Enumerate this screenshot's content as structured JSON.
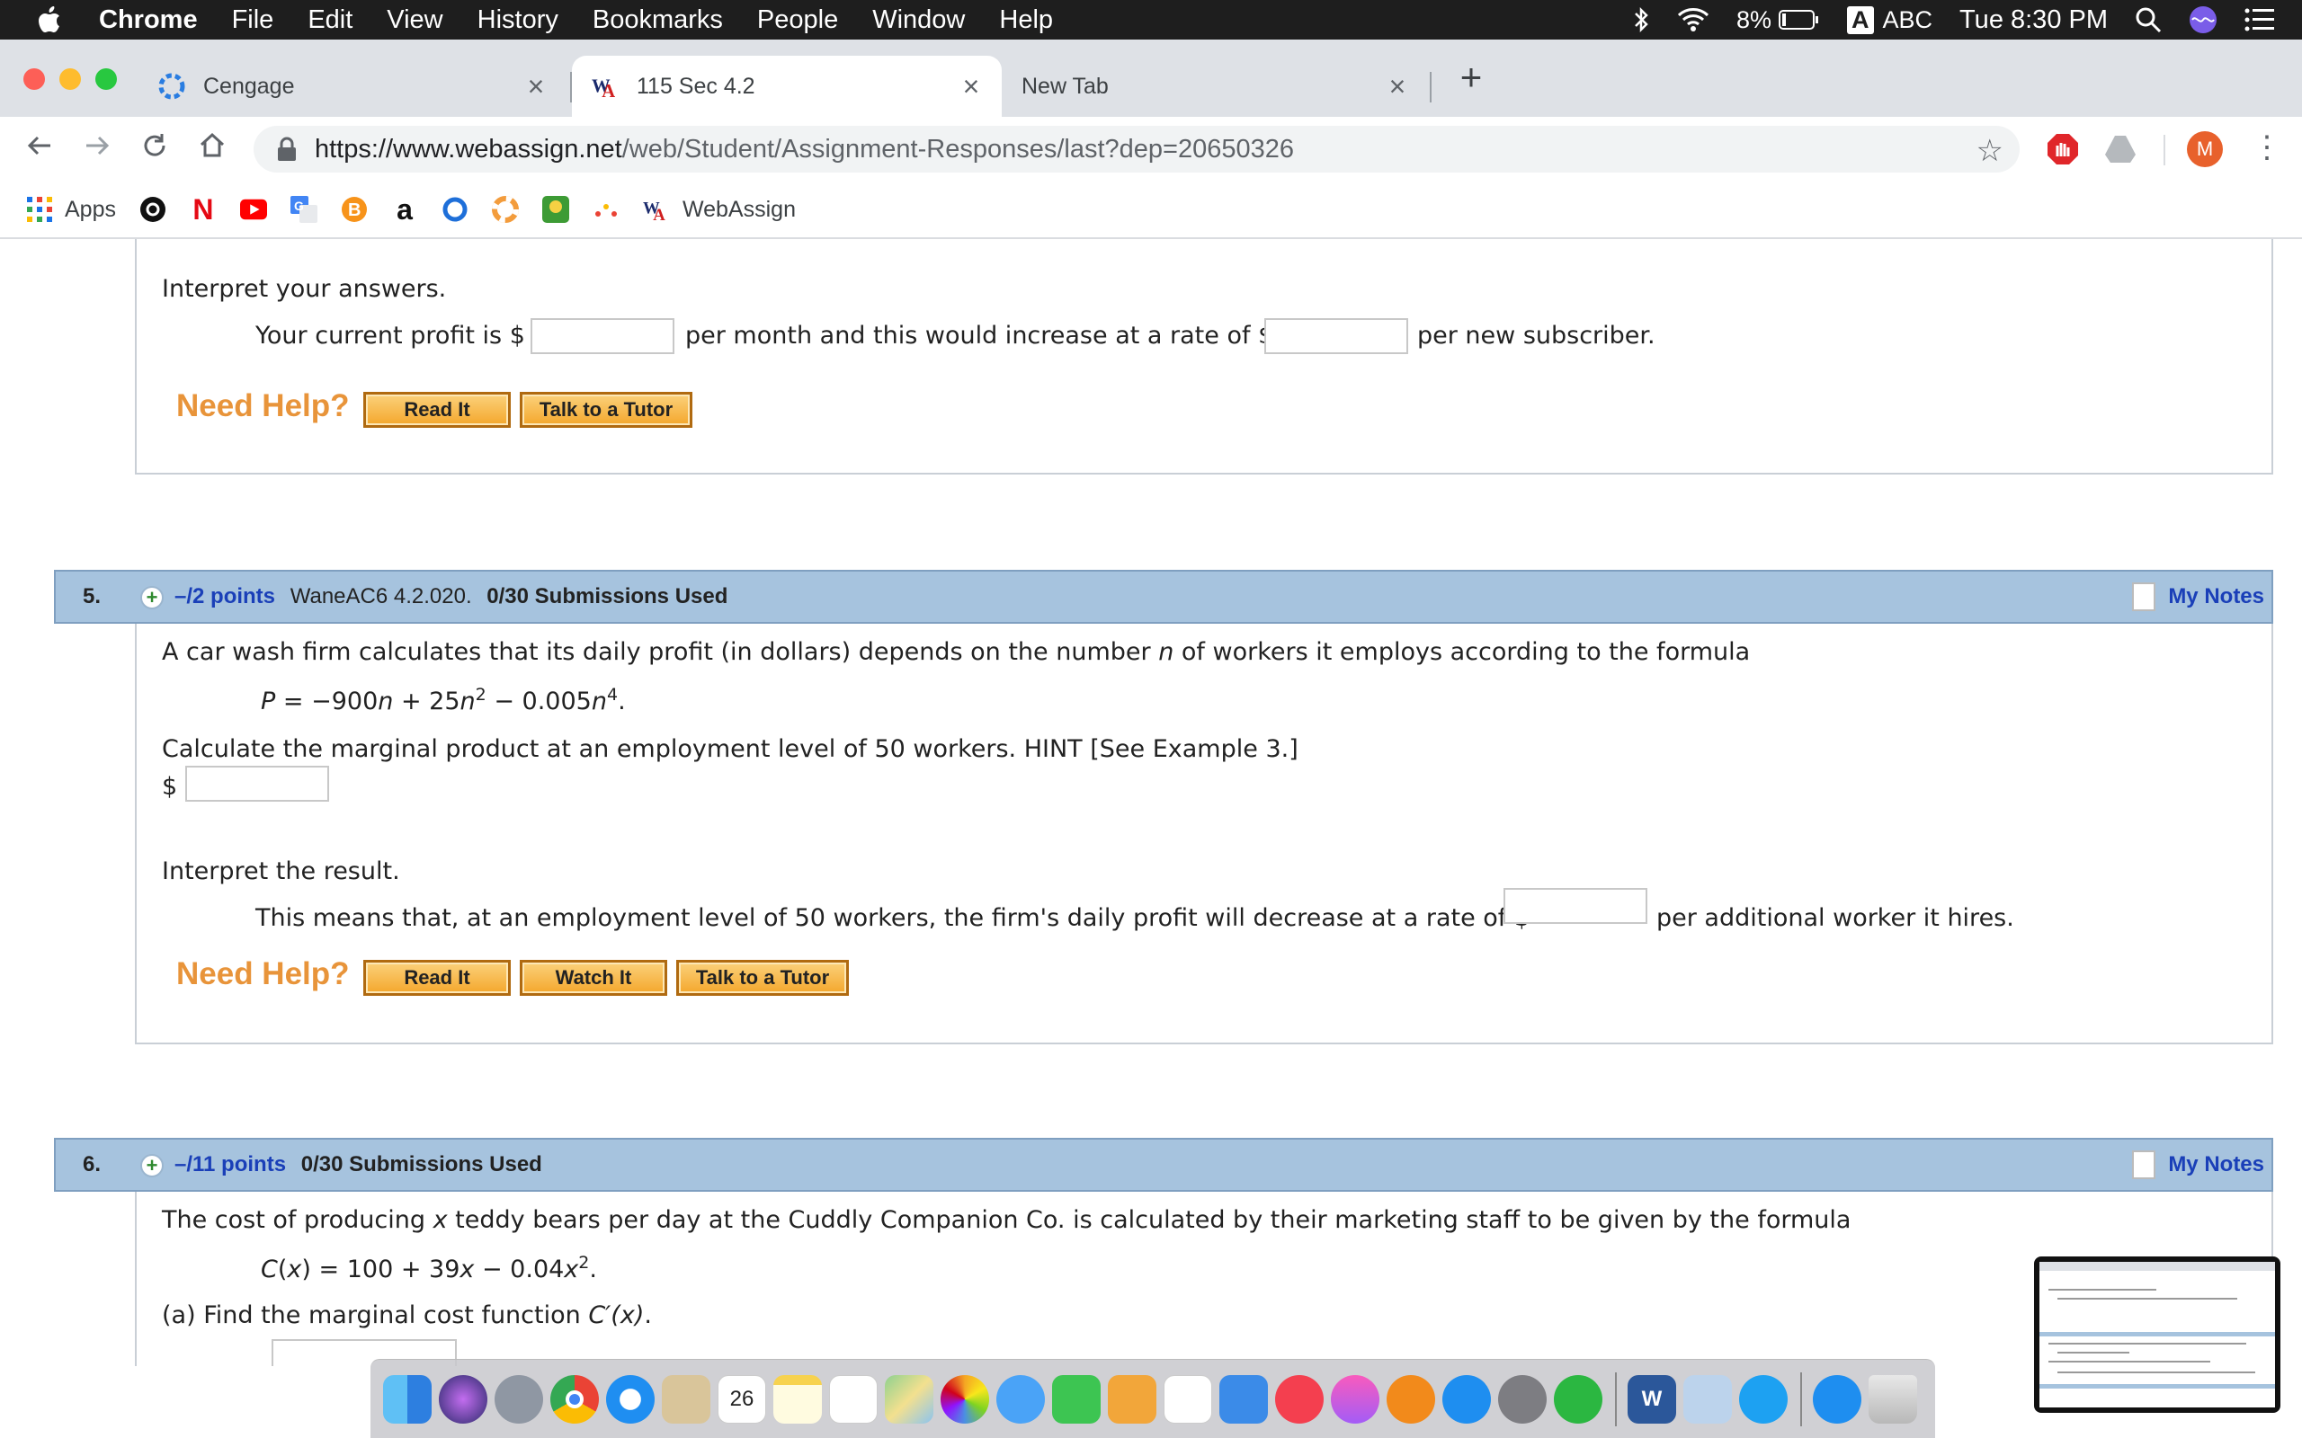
{
  "menubar": {
    "app": "Chrome",
    "items": [
      "File",
      "Edit",
      "View",
      "History",
      "Bookmarks",
      "People",
      "Window",
      "Help"
    ],
    "battery": "8%",
    "input_a": "A",
    "input": "ABC",
    "clock": "Tue 8:30 PM"
  },
  "tabs": [
    {
      "title": "Cengage"
    },
    {
      "title": "115 Sec 4.2"
    },
    {
      "title": "New Tab"
    }
  ],
  "toolbar": {
    "url_host": "https://www.webassign.net",
    "url_path": "/web/Student/Assignment-Responses/last?dep=20650326",
    "avatar_letter": "M"
  },
  "bookmarks": {
    "apps": "Apps",
    "amazon": "a",
    "webassign": "WebAssign"
  },
  "q4": {
    "interpret": "Interpret your answers.",
    "line_a": "Your current profit is $",
    "line_b": "per month and this would increase at a rate of $",
    "line_c": "per new subscriber.",
    "need_help": "Need Help?",
    "btn_read": "Read It",
    "btn_tutor": "Talk to a Tutor"
  },
  "q5": {
    "number": "5.",
    "points": "–/2 points",
    "code": "WaneAC6 4.2.020.",
    "submissions": "0/30 Submissions Used",
    "my_notes": "My Notes",
    "intro_a": "A car wash firm calculates that its daily profit (in dollars) depends on the number ",
    "intro_var": "n",
    "intro_b": " of workers it employs according to the formula",
    "f_p": "P",
    "f_1": " = −900",
    "f_n1": "n",
    "f_2": " + 25",
    "f_n2": "n",
    "f_exp2": "2",
    "f_3": " − 0.005",
    "f_n3": "n",
    "f_exp4": "4",
    "f_end": ".",
    "calc": "Calculate the marginal product at an employment level of 50 workers. HINT [See Example 3.]",
    "dollar": "$",
    "interpret": "Interpret the result.",
    "line_a": "This means that, at an employment level of 50 workers, the firm's daily profit will decrease at a rate of $",
    "line_b": "per additional worker it hires.",
    "need_help": "Need Help?",
    "btn_read": "Read It",
    "btn_watch": "Watch It",
    "btn_tutor": "Talk to a Tutor"
  },
  "q6": {
    "number": "6.",
    "points": "–/11 points",
    "submissions": "0/30 Submissions Used",
    "my_notes": "My Notes",
    "intro_a": "The cost of producing ",
    "intro_var": "x",
    "intro_b": " teddy bears per day at the Cuddly Companion Co. is calculated by their marketing staff to be given by the formula",
    "f_c": "C",
    "f_x": "x",
    "f_1": " = 100 + 39",
    "f_x2": "x",
    "f_2": " − 0.04",
    "f_x3": "x",
    "f_exp2": "2",
    "f_end": ".",
    "part_a": "(a) Find the marginal cost function ",
    "part_a_fn": "C′(x)",
    "part_a_end": "."
  },
  "dock": {
    "calendar_day": "26",
    "word": "W"
  }
}
